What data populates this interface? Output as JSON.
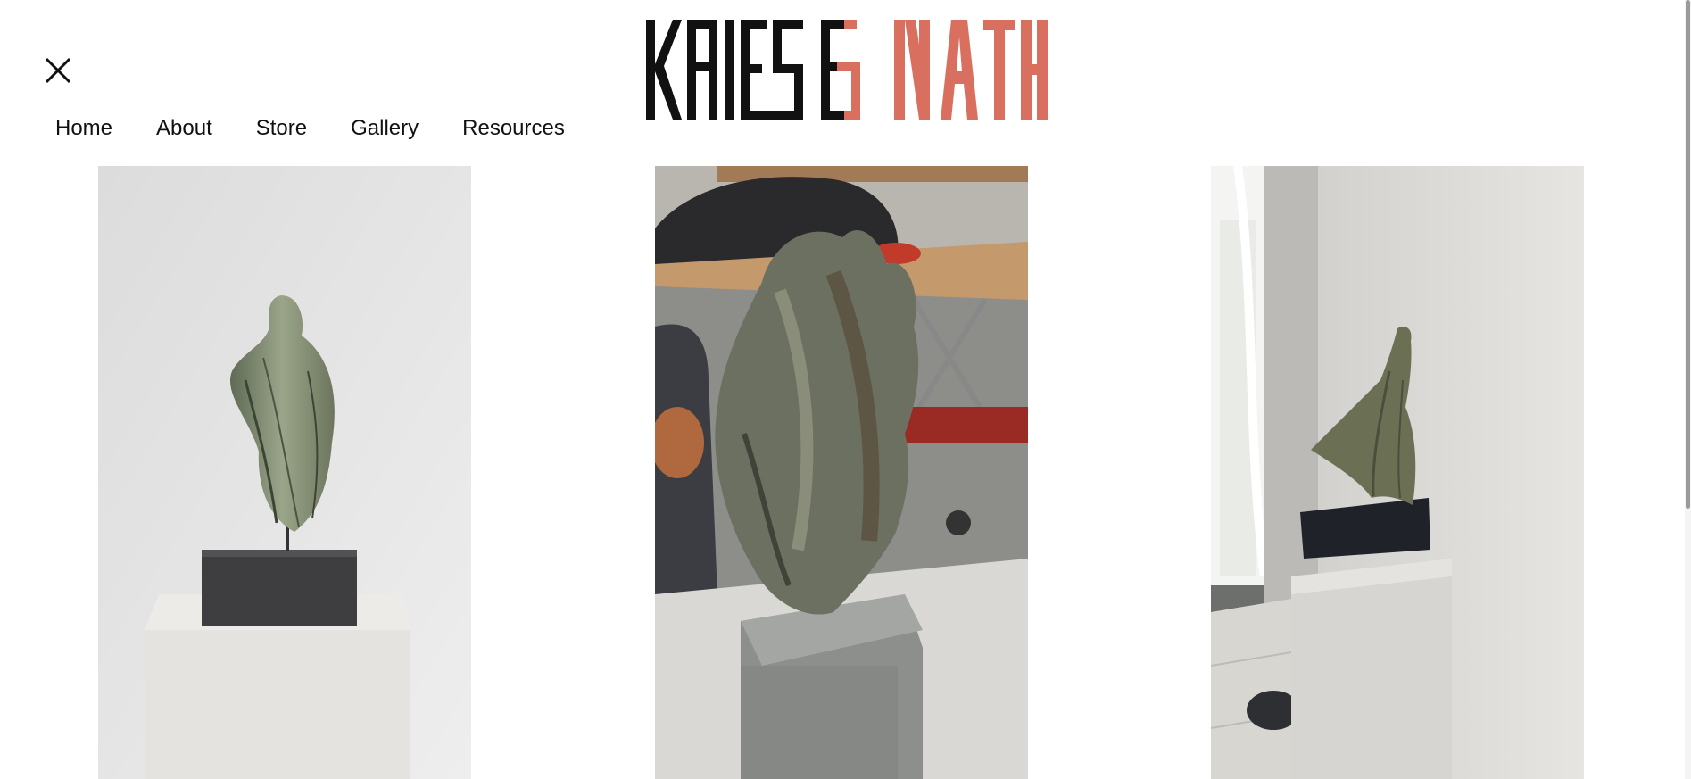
{
  "header": {
    "logo": {
      "text_part1": "KRIES",
      "text_part2": "&",
      "text_part3": "NATH",
      "primary_color": "#111111",
      "accent_color": "#d9705f"
    },
    "close_icon": "close-icon"
  },
  "nav": {
    "items": [
      {
        "label": "Home"
      },
      {
        "label": "About"
      },
      {
        "label": "Store"
      },
      {
        "label": "Gallery"
      },
      {
        "label": "Resources"
      }
    ]
  },
  "gallery": {
    "images": [
      {
        "subject": "green stone sculpture on pedestal"
      },
      {
        "subject": "stone face sculpture in workshop"
      },
      {
        "subject": "cloaked figure sculpture on pedestal"
      }
    ]
  }
}
